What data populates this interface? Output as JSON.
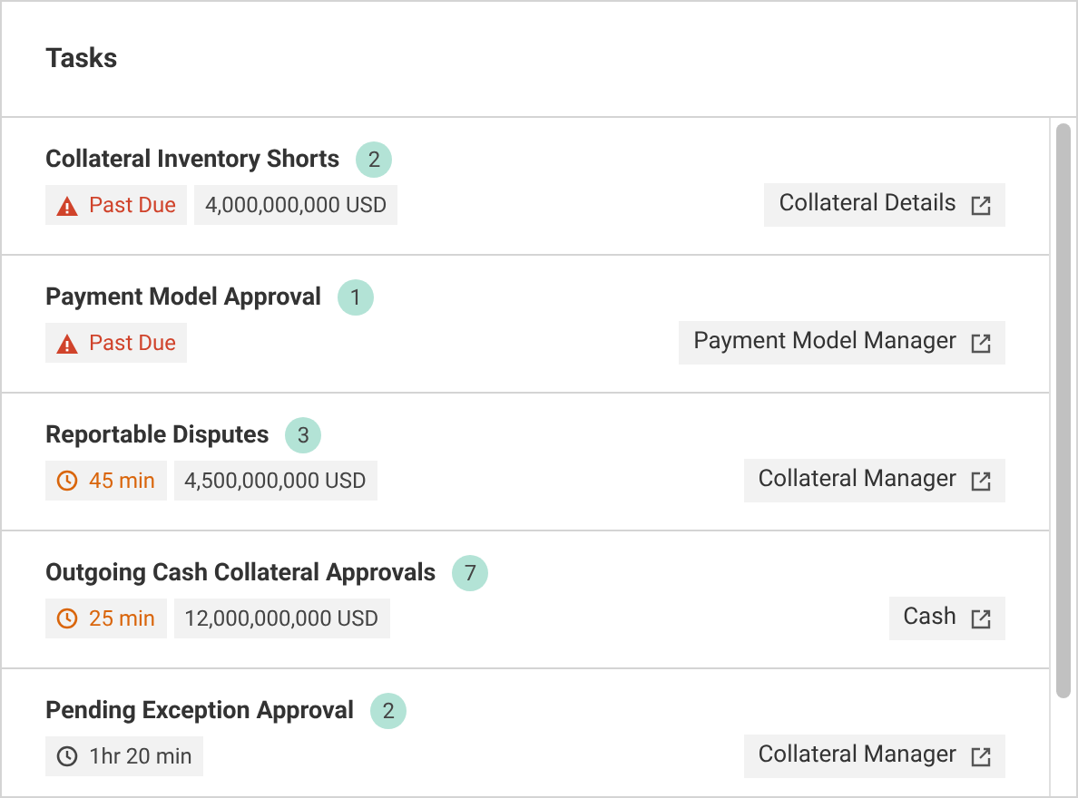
{
  "panel": {
    "title": "Tasks"
  },
  "tasks": [
    {
      "title": "Collateral Inventory Shorts",
      "count": "2",
      "status": {
        "kind": "past_due",
        "label": "Past Due"
      },
      "amount": "4,000,000,000 USD",
      "link": "Collateral Details"
    },
    {
      "title": "Payment Model Approval",
      "count": "1",
      "status": {
        "kind": "past_due",
        "label": "Past Due"
      },
      "link": "Payment Model Manager"
    },
    {
      "title": "Reportable Disputes",
      "count": "3",
      "status": {
        "kind": "soon",
        "label": "45 min"
      },
      "amount": "4,500,000,000 USD",
      "link": "Collateral Manager"
    },
    {
      "title": "Outgoing Cash Collateral Approvals",
      "count": "7",
      "status": {
        "kind": "soon",
        "label": "25 min"
      },
      "amount": "12,000,000,000 USD",
      "link": "Cash"
    },
    {
      "title": "Pending Exception Approval",
      "count": "2",
      "status": {
        "kind": "normal",
        "label": "1hr 20 min"
      },
      "link": "Collateral Manager"
    }
  ]
}
